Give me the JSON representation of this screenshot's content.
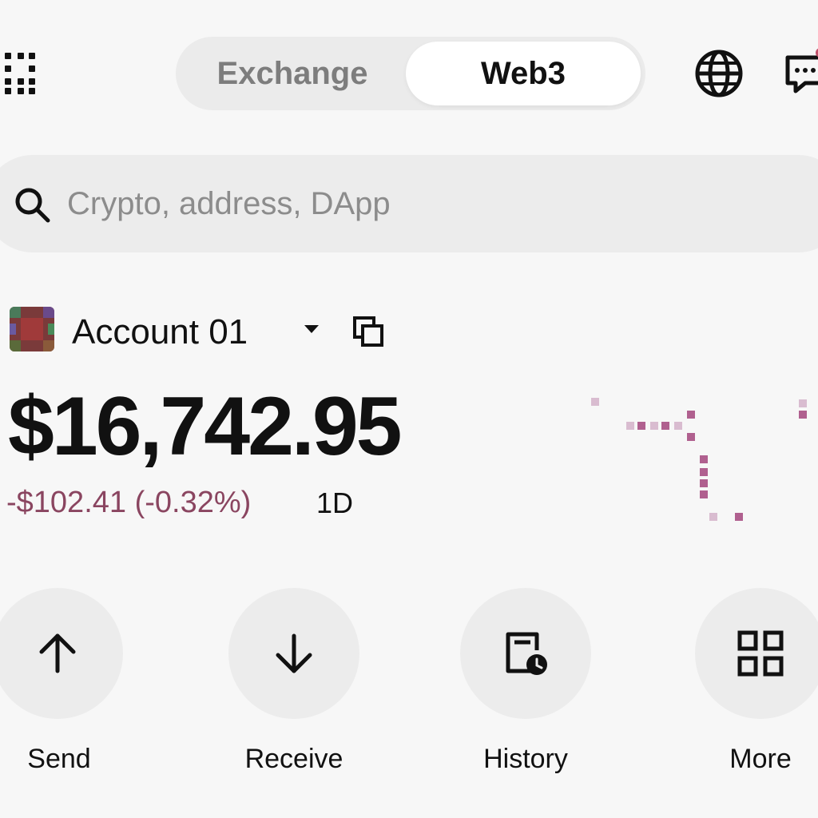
{
  "header": {
    "tabs": [
      {
        "label": "Exchange",
        "active": false
      },
      {
        "label": "Web3",
        "active": true
      }
    ],
    "icons": [
      "grid-menu-icon",
      "globe-icon",
      "chat-icon"
    ]
  },
  "search": {
    "placeholder": "Crypto, address, DApp",
    "value": ""
  },
  "account": {
    "name": "Account 01",
    "balance": "$16,742.95",
    "change": "-$102.41 (-0.32%)",
    "period": "1D"
  },
  "actions": [
    {
      "label": "Send",
      "icon": "arrow-up-icon"
    },
    {
      "label": "Receive",
      "icon": "arrow-down-icon"
    },
    {
      "label": "History",
      "icon": "history-icon"
    },
    {
      "label": "More",
      "icon": "grid-icon"
    }
  ],
  "colors": {
    "negative": "#8a4560",
    "sparkline": "#b0608f",
    "surface": "#ececec"
  }
}
